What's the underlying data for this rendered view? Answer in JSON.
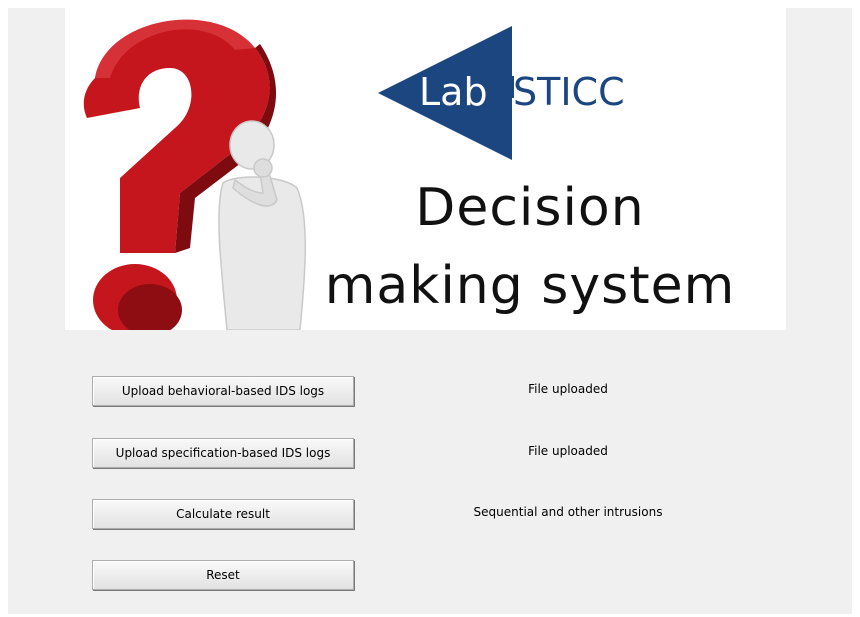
{
  "banner": {
    "logo_prefix": "Lab",
    "logo_suffix": "STICC",
    "headline_line1": "Decision",
    "headline_line2": "making system",
    "logo_color": "#1c4680",
    "question_mark_color": "#c4161c"
  },
  "actions": [
    {
      "button_label": "Upload behavioral-based IDS logs",
      "status": "File uploaded"
    },
    {
      "button_label": "Upload specification-based IDS logs",
      "status": "File uploaded"
    },
    {
      "button_label": "Calculate result",
      "status": "Sequential and other intrusions"
    },
    {
      "button_label": "Reset",
      "status": ""
    }
  ]
}
